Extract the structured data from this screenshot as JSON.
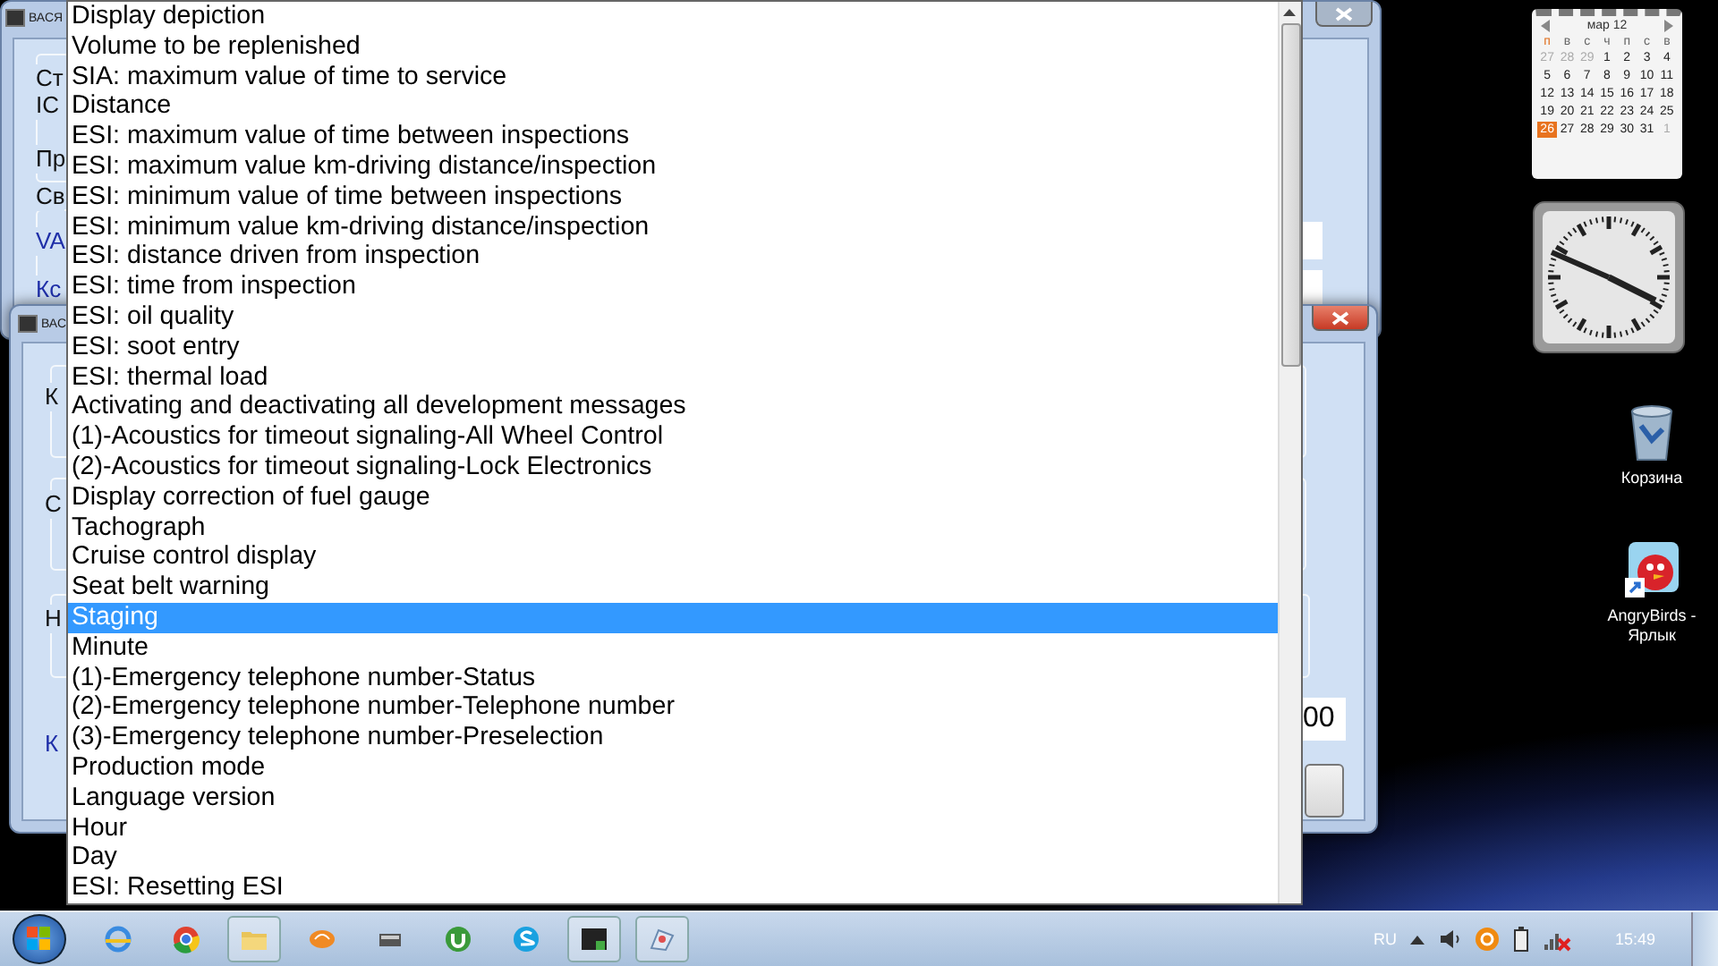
{
  "windows": [
    {
      "title": "ВАСЯ",
      "labels": [
        {
          "text": "Ст",
          "link": false
        },
        {
          "text": "IC",
          "link": false
        },
        {
          "text": "Пр",
          "link": false
        },
        {
          "text": "Св",
          "link": false
        },
        {
          "text": "VA",
          "link": true
        },
        {
          "text": "Кс",
          "link": true
        }
      ]
    },
    {
      "title": "ВАС",
      "labels": [
        {
          "text": "К",
          "link": false
        },
        {
          "text": "С",
          "link": false
        },
        {
          "text": "Н",
          "link": false
        },
        {
          "text": "К",
          "link": true
        }
      ],
      "field_value": "00"
    }
  ],
  "dropdown": {
    "items": [
      {
        "label": "Display depiction",
        "selected": false
      },
      {
        "label": "Volume to be replenished",
        "selected": false
      },
      {
        "label": "SIA: maximum value of time to service",
        "selected": false
      },
      {
        "label": "Distance",
        "selected": false
      },
      {
        "label": "ESI: maximum value of time between inspections",
        "selected": false
      },
      {
        "label": "ESI: maximum value km-driving distance/inspection",
        "selected": false
      },
      {
        "label": "ESI: minimum value of time between inspections",
        "selected": false
      },
      {
        "label": "ESI: minimum value km-driving distance/inspection",
        "selected": false
      },
      {
        "label": "ESI: distance driven from inspection",
        "selected": false
      },
      {
        "label": "ESI: time from inspection",
        "selected": false
      },
      {
        "label": "ESI: oil quality",
        "selected": false
      },
      {
        "label": "ESI: soot entry",
        "selected": false
      },
      {
        "label": "ESI: thermal load",
        "selected": false
      },
      {
        "label": "Activating and deactivating all development messages",
        "selected": false
      },
      {
        "label": "(1)-Acoustics for timeout signaling-All Wheel Control",
        "selected": false
      },
      {
        "label": "(2)-Acoustics for timeout signaling-Lock Electronics",
        "selected": false
      },
      {
        "label": "Display correction of fuel gauge",
        "selected": false
      },
      {
        "label": "Tachograph",
        "selected": false
      },
      {
        "label": "Cruise control display",
        "selected": false
      },
      {
        "label": "Seat belt warning",
        "selected": false
      },
      {
        "label": "Staging",
        "selected": true
      },
      {
        "label": "Minute",
        "selected": false
      },
      {
        "label": "(1)-Emergency telephone number-Status",
        "selected": false
      },
      {
        "label": "(2)-Emergency telephone number-Telephone number",
        "selected": false
      },
      {
        "label": "(3)-Emergency telephone number-Preselection",
        "selected": false
      },
      {
        "label": "Production mode",
        "selected": false
      },
      {
        "label": "Language version",
        "selected": false
      },
      {
        "label": "Hour",
        "selected": false
      },
      {
        "label": "Day",
        "selected": false
      },
      {
        "label": "ESI: Resetting ESI",
        "selected": false
      }
    ]
  },
  "calendar": {
    "month": "мар 12",
    "weekdays": [
      "п",
      "в",
      "с",
      "ч",
      "п",
      "с",
      "в"
    ],
    "days": [
      {
        "label": "27",
        "muted": true,
        "selected": false
      },
      {
        "label": "28",
        "muted": true,
        "selected": false
      },
      {
        "label": "29",
        "muted": true,
        "selected": false
      },
      {
        "label": "1",
        "muted": false,
        "selected": false
      },
      {
        "label": "2",
        "muted": false,
        "selected": false
      },
      {
        "label": "3",
        "muted": false,
        "selected": false
      },
      {
        "label": "4",
        "muted": false,
        "selected": false
      },
      {
        "label": "5",
        "muted": false,
        "selected": false
      },
      {
        "label": "6",
        "muted": false,
        "selected": false
      },
      {
        "label": "7",
        "muted": false,
        "selected": false
      },
      {
        "label": "8",
        "muted": false,
        "selected": false
      },
      {
        "label": "9",
        "muted": false,
        "selected": false
      },
      {
        "label": "10",
        "muted": false,
        "selected": false
      },
      {
        "label": "11",
        "muted": false,
        "selected": false
      },
      {
        "label": "12",
        "muted": false,
        "selected": false
      },
      {
        "label": "13",
        "muted": false,
        "selected": false
      },
      {
        "label": "14",
        "muted": false,
        "selected": false
      },
      {
        "label": "15",
        "muted": false,
        "selected": false
      },
      {
        "label": "16",
        "muted": false,
        "selected": false
      },
      {
        "label": "17",
        "muted": false,
        "selected": false
      },
      {
        "label": "18",
        "muted": false,
        "selected": false
      },
      {
        "label": "19",
        "muted": false,
        "selected": false
      },
      {
        "label": "20",
        "muted": false,
        "selected": false
      },
      {
        "label": "21",
        "muted": false,
        "selected": false
      },
      {
        "label": "22",
        "muted": false,
        "selected": false
      },
      {
        "label": "23",
        "muted": false,
        "selected": false
      },
      {
        "label": "24",
        "muted": false,
        "selected": false
      },
      {
        "label": "25",
        "muted": false,
        "selected": false
      },
      {
        "label": "26",
        "muted": false,
        "selected": true
      },
      {
        "label": "27",
        "muted": false,
        "selected": false
      },
      {
        "label": "28",
        "muted": false,
        "selected": false
      },
      {
        "label": "29",
        "muted": false,
        "selected": false
      },
      {
        "label": "30",
        "muted": false,
        "selected": false
      },
      {
        "label": "31",
        "muted": false,
        "selected": false
      },
      {
        "label": "1",
        "muted": true,
        "selected": false
      }
    ]
  },
  "desktop_icons": [
    {
      "label": "Корзина",
      "kind": "bin"
    },
    {
      "label": "AngryBirds - Ярлык",
      "kind": "bird"
    }
  ],
  "taskbar": {
    "language": "RU",
    "time": "15:49"
  }
}
